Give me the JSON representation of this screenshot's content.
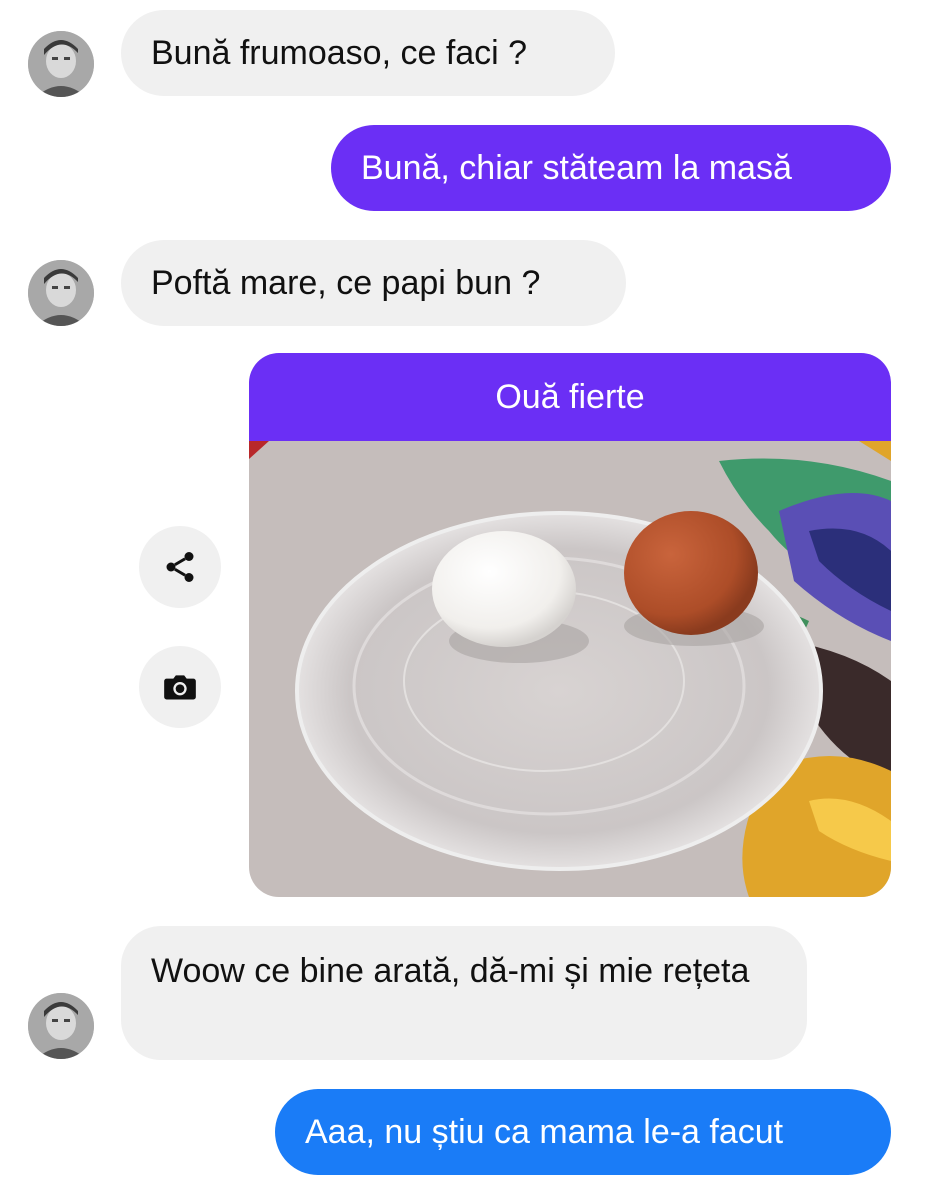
{
  "colors": {
    "incoming_bubble": "#f0f0f0",
    "outgoing_purple": "#6b2ff5",
    "outgoing_blue": "#1a7cf7"
  },
  "messages": [
    {
      "direction": "incoming",
      "text": "Bună frumoaso, ce faci ?"
    },
    {
      "direction": "outgoing",
      "text": "Bună, chiar stăteam la masă"
    },
    {
      "direction": "incoming",
      "text": "Poftă mare, ce papi bun ?"
    },
    {
      "direction": "outgoing",
      "type": "photo",
      "caption": "Ouă fierte"
    },
    {
      "direction": "incoming",
      "text": "Woow ce bine arată, dă-mi și mie rețeta"
    },
    {
      "direction": "outgoing",
      "text": "Aaa, nu știu ca mama le-a facut"
    }
  ],
  "photo_actions": {
    "share_icon": "share-icon",
    "camera_icon": "camera-icon"
  }
}
